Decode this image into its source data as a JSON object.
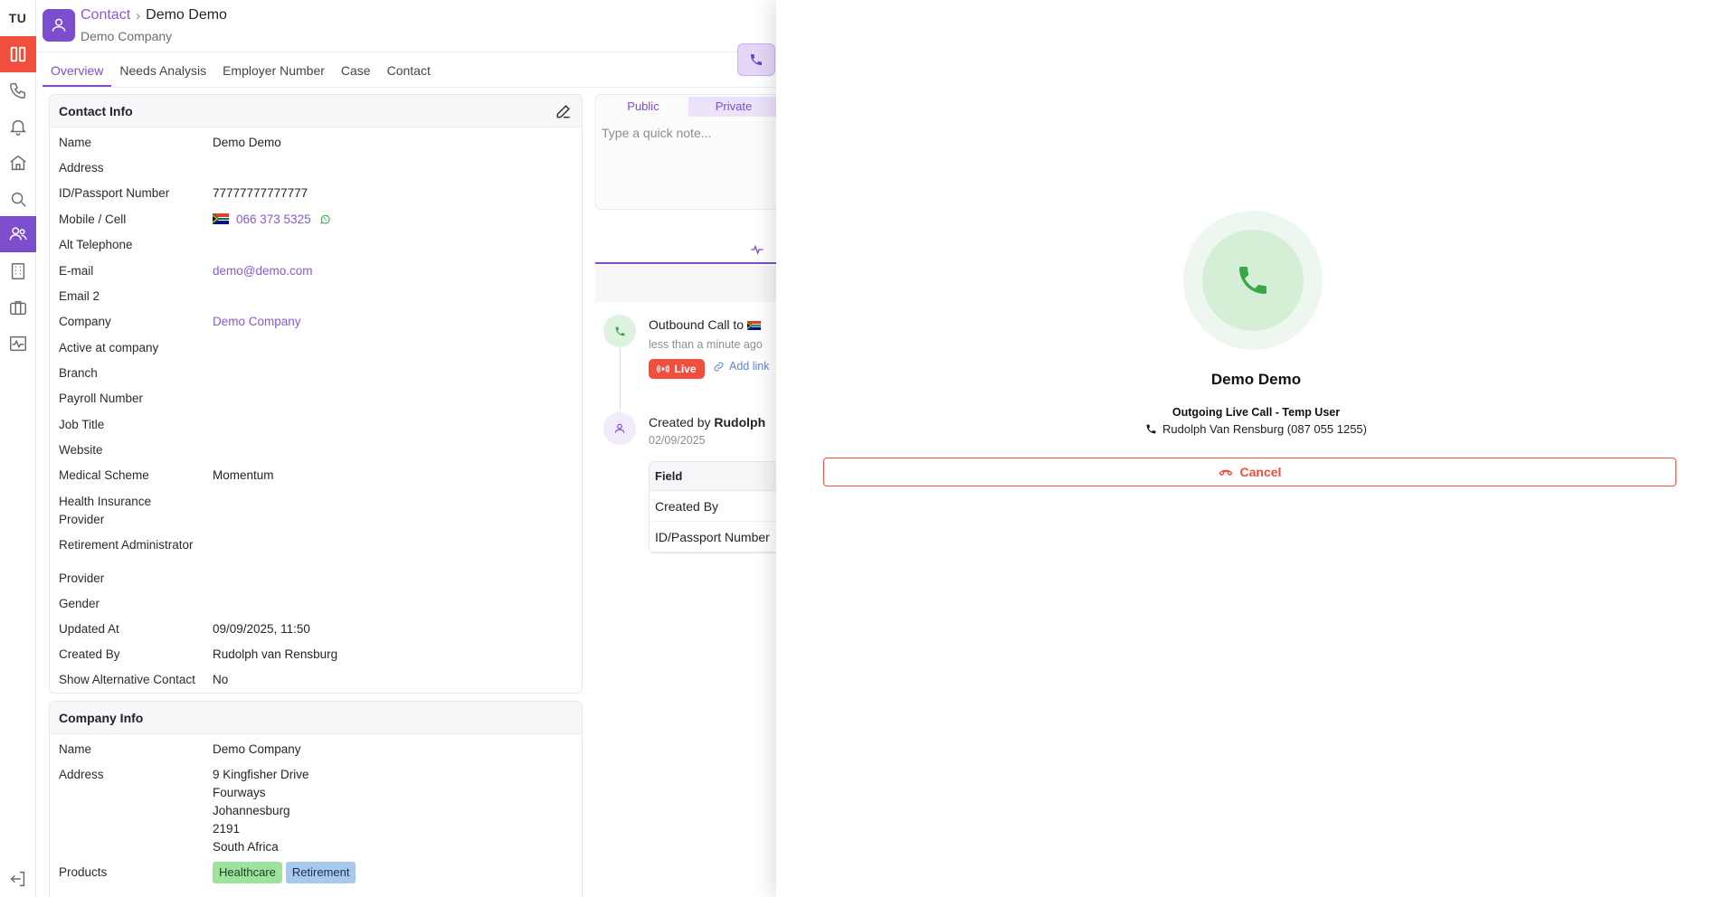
{
  "user": {
    "initials": "TU"
  },
  "rail": {
    "items": [
      {
        "icon": "columns-icon",
        "active_color": "#ef4f3c"
      },
      {
        "icon": "phone-icon"
      },
      {
        "icon": "bell-icon"
      },
      {
        "icon": "home-icon"
      },
      {
        "icon": "search-icon"
      },
      {
        "icon": "users-icon",
        "active_color": "#7c4dcc"
      },
      {
        "icon": "building-icon"
      },
      {
        "icon": "briefcase-icon"
      },
      {
        "icon": "activity-icon"
      },
      {
        "icon": "logout-icon"
      }
    ]
  },
  "header": {
    "breadcrumb_parent": "Contact",
    "breadcrumb_current": "Demo Demo",
    "subtitle": "Demo Company"
  },
  "tabs": [
    "Overview",
    "Needs Analysis",
    "Employer Number",
    "Case",
    "Contact"
  ],
  "contact_info": {
    "title": "Contact Info",
    "rows": [
      {
        "label": "Name",
        "value": "Demo Demo"
      },
      {
        "label": "Address",
        "value": ""
      },
      {
        "label": "ID/Passport Number",
        "value": "77777777777777"
      },
      {
        "label": "Mobile / Cell",
        "value": "066 373 5325"
      },
      {
        "label": "Alt Telephone",
        "value": ""
      },
      {
        "label": "E-mail",
        "value": "demo@demo.com"
      },
      {
        "label": "Email 2",
        "value": ""
      },
      {
        "label": "Company",
        "value": "Demo Company"
      },
      {
        "label": "Active at company",
        "value": ""
      },
      {
        "label": "Branch",
        "value": ""
      },
      {
        "label": "Payroll Number",
        "value": ""
      },
      {
        "label": "Job Title",
        "value": ""
      },
      {
        "label": "Website",
        "value": ""
      },
      {
        "label": "Medical Scheme",
        "value": "Momentum"
      },
      {
        "label": "Health Insurance",
        "value": ""
      },
      {
        "label": "Provider",
        "value": ""
      },
      {
        "label": "Retirement Administrator",
        "value": ""
      },
      {
        "label": "Provider",
        "value": ""
      },
      {
        "label": "Gender",
        "value": ""
      },
      {
        "label": "Updated At",
        "value": "09/09/2025, 11:50"
      },
      {
        "label": "Created By",
        "value": "Rudolph van Rensburg"
      },
      {
        "label": "Show Alternative Contact",
        "value": "No"
      }
    ]
  },
  "company_info": {
    "title": "Company Info",
    "name_label": "Name",
    "name": "Demo Company",
    "address_label": "Address",
    "address_lines": [
      "9 Kingfisher Drive",
      "Fourways",
      "Johannesburg",
      "2191",
      "South Africa"
    ],
    "products_label": "Products",
    "products": [
      "Healthcare",
      "Retirement"
    ]
  },
  "notes": {
    "public_label": "Public",
    "private_label": "Private",
    "placeholder": "Type a quick note..."
  },
  "activity": {
    "call_title_prefix": "Outbound Call to",
    "call_time": "less than a minute ago",
    "live_label": "Live",
    "add_link_label": "Add link",
    "created_prefix": "Created by",
    "created_by": "Rudolph",
    "created_date": "02/09/2025",
    "table": {
      "header": "Field",
      "rows": [
        "Created By",
        "ID/Passport Number"
      ]
    }
  },
  "call_overlay": {
    "contact_name": "Demo Demo",
    "status": "Outgoing Live Call - Temp User",
    "agent_line": "Rudolph Van Rensburg (087 055 1255)",
    "cancel_label": "Cancel",
    "accent": "#ef4f3c",
    "phone_color": "#3aa64a"
  }
}
